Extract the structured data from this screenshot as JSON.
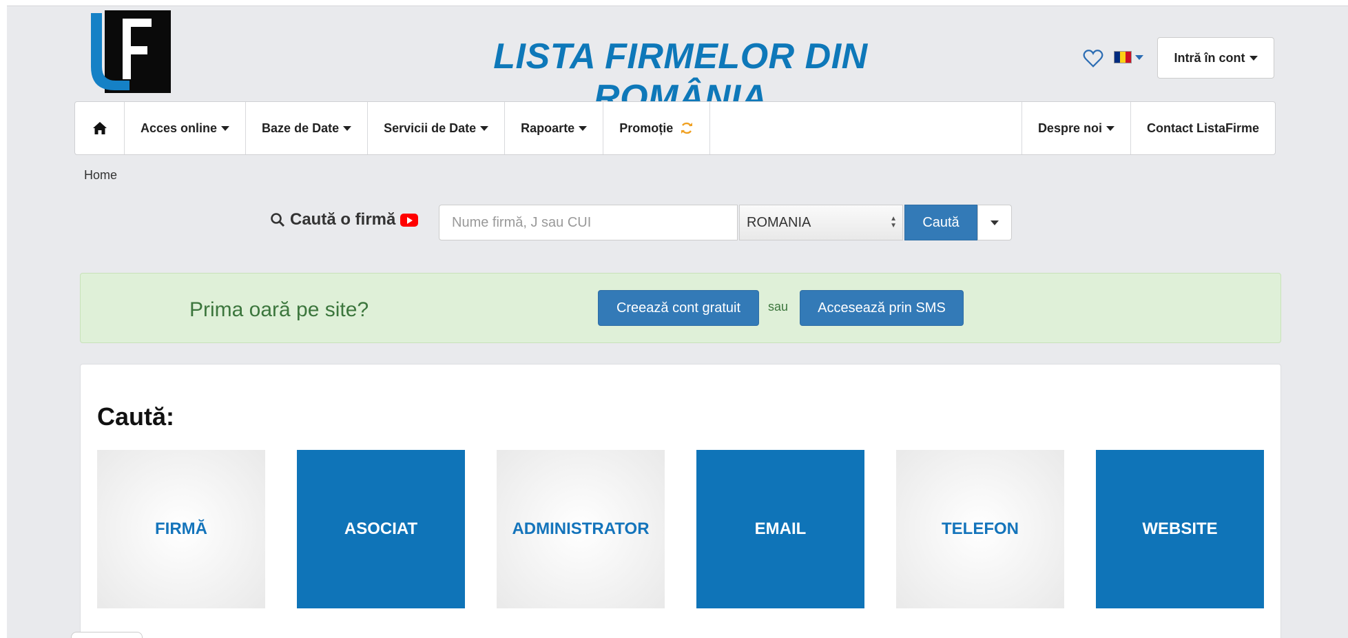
{
  "header": {
    "title": "LISTA FIRMELOR DIN ROMÂNIA",
    "logo_icon": "lf-logo-icon",
    "favorites_icon": "heart-icon",
    "language_flag": "romania-flag-icon",
    "login_label": "Intră în cont"
  },
  "nav": {
    "home_icon": "home-icon",
    "items": [
      {
        "label": "Acces online",
        "dropdown": true
      },
      {
        "label": "Baze de Date",
        "dropdown": true
      },
      {
        "label": "Servicii de Date",
        "dropdown": true
      },
      {
        "label": "Rapoarte",
        "dropdown": true
      },
      {
        "label": "Promoție",
        "dropdown": false,
        "icon": "refresh-icon"
      }
    ],
    "right_items": [
      {
        "label": "Despre noi",
        "dropdown": true
      },
      {
        "label": "Contact ListaFirme",
        "dropdown": false
      }
    ]
  },
  "breadcrumb": "Home",
  "search": {
    "label": "Caută o firmă",
    "label_icon": "search-icon",
    "video_icon": "youtube-icon",
    "placeholder": "Nume firmă, J sau CUI",
    "value": "",
    "country": "ROMANIA",
    "button": "Caută"
  },
  "alert": {
    "text": "Prima oară pe site?",
    "create_button": "Creează cont gratuit",
    "or_text": "sau",
    "sms_button": "Accesează prin SMS"
  },
  "search_panel": {
    "title": "Caută:",
    "tiles": [
      "FIRMĂ",
      "ASOCIAT",
      "ADMINISTRATOR",
      "EMAIL",
      "TELEFON",
      "WEBSITE"
    ]
  },
  "colors": {
    "brand_blue": "#0e78b9",
    "button_blue": "#337ab7",
    "alert_green_bg": "#dff0d8",
    "alert_green_text": "#3c763d",
    "page_bg": "#e9eaed"
  }
}
